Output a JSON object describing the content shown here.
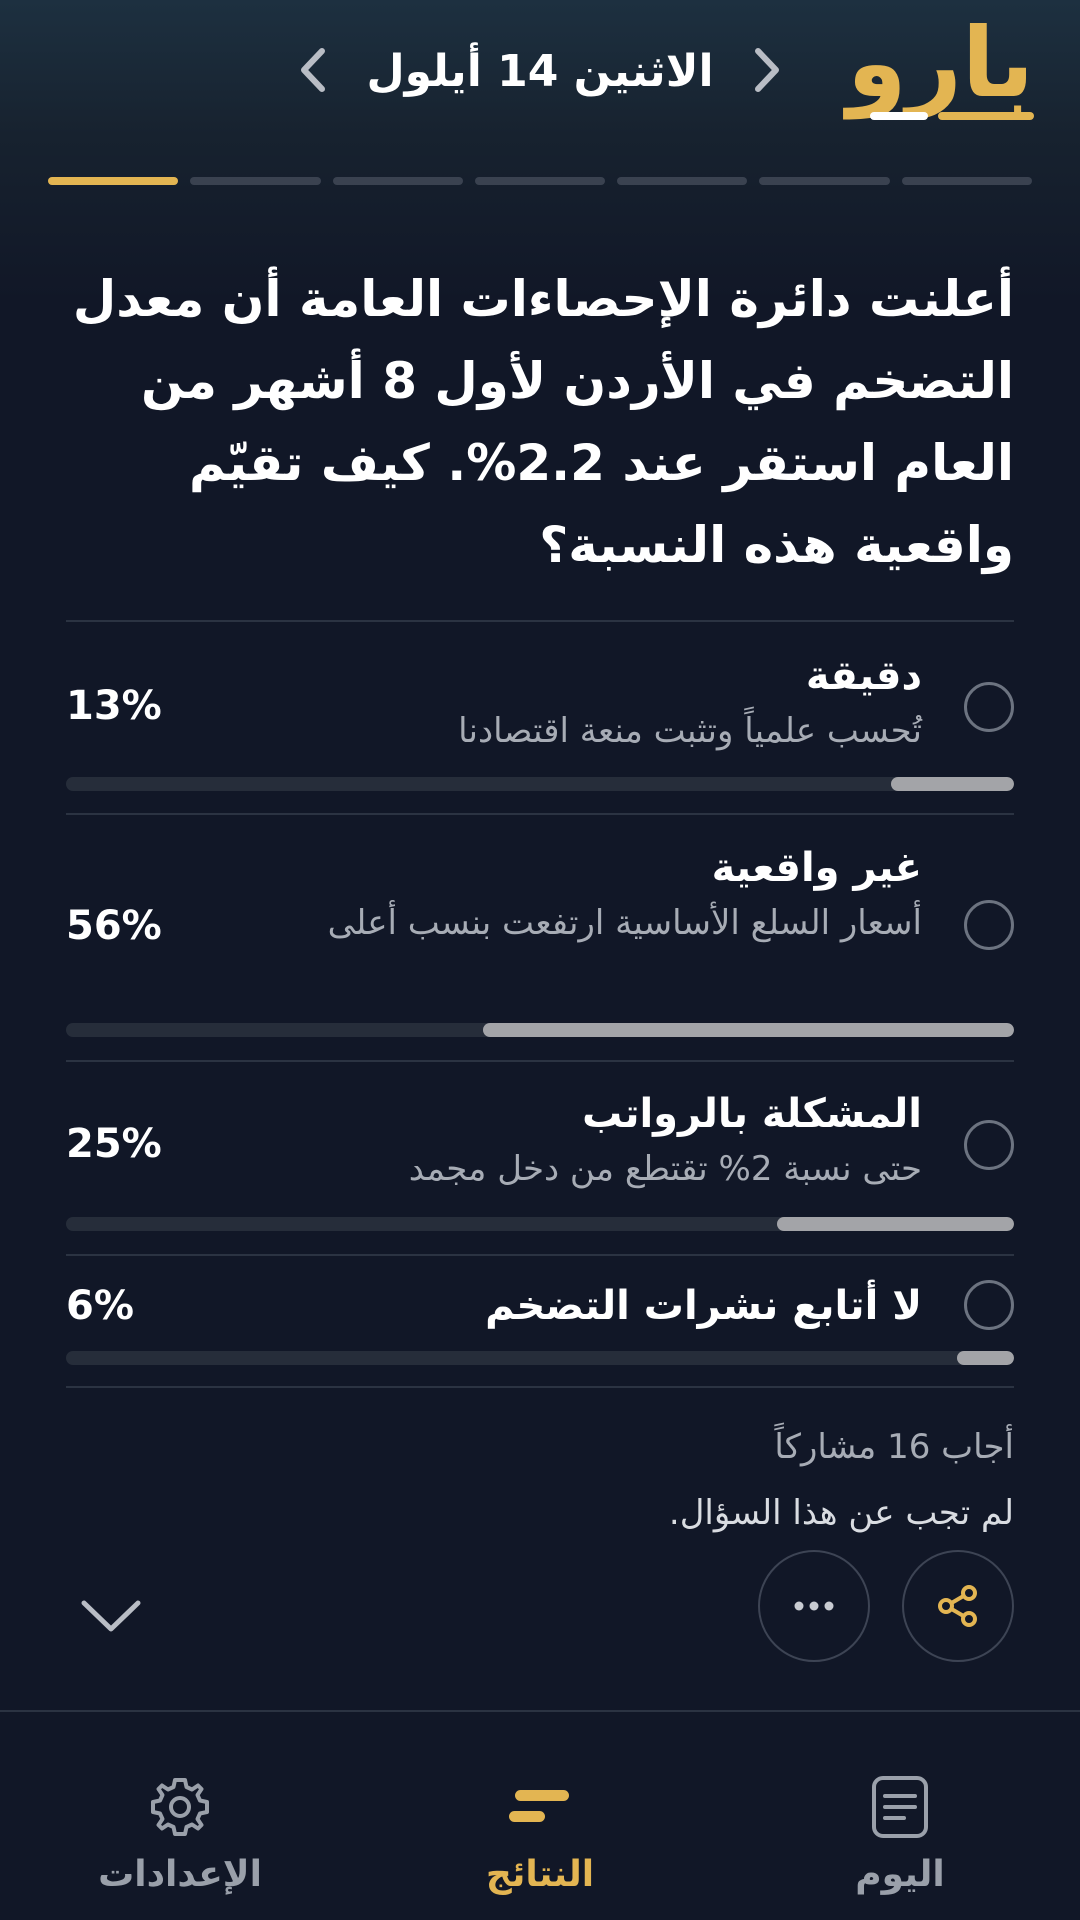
{
  "header": {
    "logo_text": "بارو",
    "date_title": "الاثنين 14 أيلول",
    "progress_segments": 7,
    "active_segment": 1
  },
  "question": {
    "text": "أعلنت دائرة الإحصاءات العامة أن معدل التضخم في الأردن لأول 8 أشهر من العام استقر عند 2.2%. كيف تقيّم واقعية هذه النسبة؟"
  },
  "options": [
    {
      "title": "دقيقة",
      "subtitle": "تُحسب علمياً وتثبت منعة اقتصادنا",
      "percent_label": "13%",
      "percent": 13
    },
    {
      "title": "غير واقعية",
      "subtitle": "أسعار السلع الأساسية ارتفعت بنسب أعلى",
      "percent_label": "56%",
      "percent": 56
    },
    {
      "title": "المشكلة بالرواتب",
      "subtitle": "حتى نسبة 2% تقتطع من دخل مجمد",
      "percent_label": "25%",
      "percent": 25
    },
    {
      "title": "لا أتابع نشرات التضخم",
      "subtitle": "",
      "percent_label": "6%",
      "percent": 6
    }
  ],
  "stats": {
    "participants": "أجاب 16 مشاركاً",
    "note": "لم تجب عن هذا السؤال."
  },
  "icons": {
    "share": "share-icon",
    "more": "more-dots-icon",
    "collapse": "chevron-down-icon"
  },
  "bottom_nav": {
    "settings_label": "الإعدادات",
    "results_label": "النتائج",
    "today_label": "اليوم"
  },
  "colors": {
    "accent": "#e3b552",
    "background": "#111727",
    "bar_fill": "#a3a4a8"
  }
}
